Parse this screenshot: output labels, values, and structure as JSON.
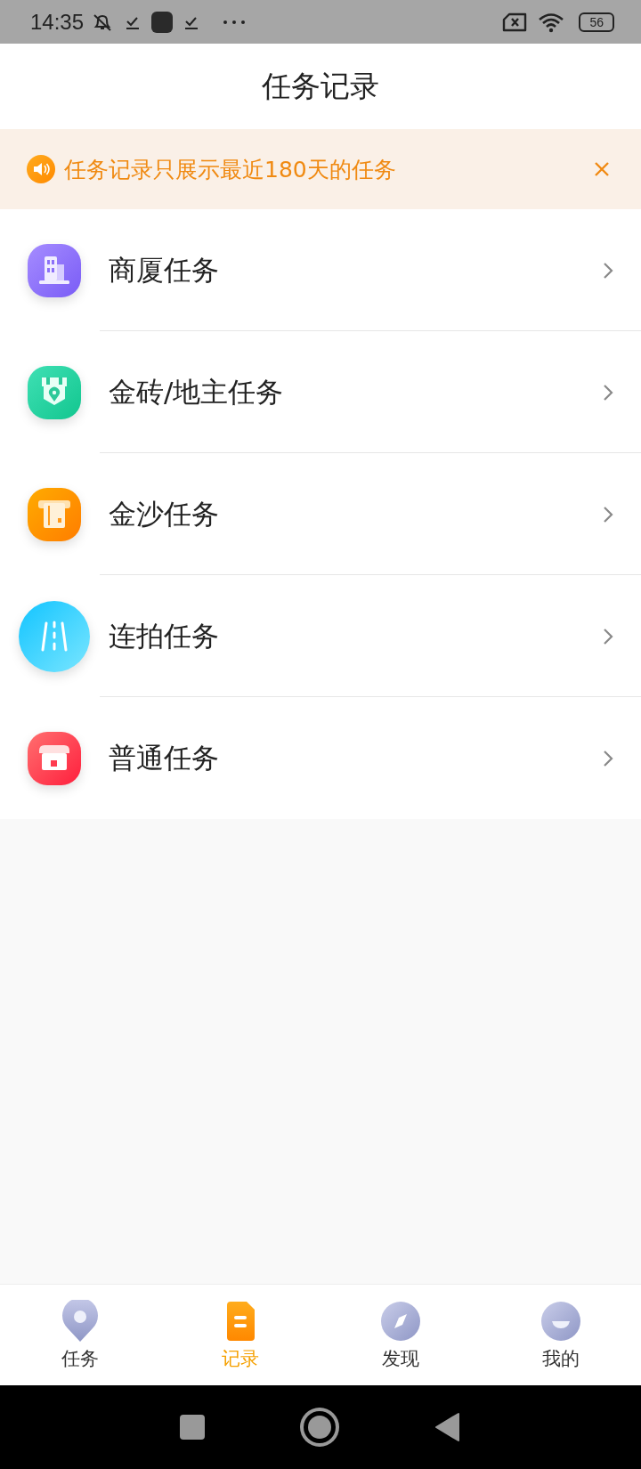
{
  "status_bar": {
    "time": "14:35",
    "battery": "56"
  },
  "header": {
    "title": "任务记录"
  },
  "notice": {
    "text": "任务记录只展示最近180天的任务",
    "closable": true
  },
  "tasks": [
    {
      "label": "商厦任务",
      "kind": "building"
    },
    {
      "label": "金砖/地主任务",
      "kind": "badge"
    },
    {
      "label": "金沙任务",
      "kind": "card"
    },
    {
      "label": "连拍任务",
      "kind": "road"
    },
    {
      "label": "普通任务",
      "kind": "shop"
    }
  ],
  "tabs": [
    {
      "label": "任务",
      "kind": "pin",
      "selected": false
    },
    {
      "label": "记录",
      "kind": "doc",
      "selected": true
    },
    {
      "label": "发现",
      "kind": "compass",
      "selected": false
    },
    {
      "label": "我的",
      "kind": "user",
      "selected": false
    }
  ]
}
